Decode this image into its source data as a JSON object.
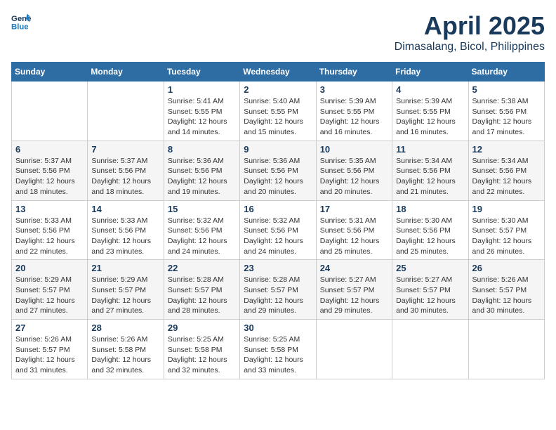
{
  "header": {
    "logo_line1": "General",
    "logo_line2": "Blue",
    "title": "April 2025",
    "subtitle": "Dimasalang, Bicol, Philippines"
  },
  "calendar": {
    "days_of_week": [
      "Sunday",
      "Monday",
      "Tuesday",
      "Wednesday",
      "Thursday",
      "Friday",
      "Saturday"
    ],
    "weeks": [
      [
        {
          "day": "",
          "info": ""
        },
        {
          "day": "",
          "info": ""
        },
        {
          "day": "1",
          "info": "Sunrise: 5:41 AM\nSunset: 5:55 PM\nDaylight: 12 hours\nand 14 minutes."
        },
        {
          "day": "2",
          "info": "Sunrise: 5:40 AM\nSunset: 5:55 PM\nDaylight: 12 hours\nand 15 minutes."
        },
        {
          "day": "3",
          "info": "Sunrise: 5:39 AM\nSunset: 5:55 PM\nDaylight: 12 hours\nand 16 minutes."
        },
        {
          "day": "4",
          "info": "Sunrise: 5:39 AM\nSunset: 5:55 PM\nDaylight: 12 hours\nand 16 minutes."
        },
        {
          "day": "5",
          "info": "Sunrise: 5:38 AM\nSunset: 5:56 PM\nDaylight: 12 hours\nand 17 minutes."
        }
      ],
      [
        {
          "day": "6",
          "info": "Sunrise: 5:37 AM\nSunset: 5:56 PM\nDaylight: 12 hours\nand 18 minutes."
        },
        {
          "day": "7",
          "info": "Sunrise: 5:37 AM\nSunset: 5:56 PM\nDaylight: 12 hours\nand 18 minutes."
        },
        {
          "day": "8",
          "info": "Sunrise: 5:36 AM\nSunset: 5:56 PM\nDaylight: 12 hours\nand 19 minutes."
        },
        {
          "day": "9",
          "info": "Sunrise: 5:36 AM\nSunset: 5:56 PM\nDaylight: 12 hours\nand 20 minutes."
        },
        {
          "day": "10",
          "info": "Sunrise: 5:35 AM\nSunset: 5:56 PM\nDaylight: 12 hours\nand 20 minutes."
        },
        {
          "day": "11",
          "info": "Sunrise: 5:34 AM\nSunset: 5:56 PM\nDaylight: 12 hours\nand 21 minutes."
        },
        {
          "day": "12",
          "info": "Sunrise: 5:34 AM\nSunset: 5:56 PM\nDaylight: 12 hours\nand 22 minutes."
        }
      ],
      [
        {
          "day": "13",
          "info": "Sunrise: 5:33 AM\nSunset: 5:56 PM\nDaylight: 12 hours\nand 22 minutes."
        },
        {
          "day": "14",
          "info": "Sunrise: 5:33 AM\nSunset: 5:56 PM\nDaylight: 12 hours\nand 23 minutes."
        },
        {
          "day": "15",
          "info": "Sunrise: 5:32 AM\nSunset: 5:56 PM\nDaylight: 12 hours\nand 24 minutes."
        },
        {
          "day": "16",
          "info": "Sunrise: 5:32 AM\nSunset: 5:56 PM\nDaylight: 12 hours\nand 24 minutes."
        },
        {
          "day": "17",
          "info": "Sunrise: 5:31 AM\nSunset: 5:56 PM\nDaylight: 12 hours\nand 25 minutes."
        },
        {
          "day": "18",
          "info": "Sunrise: 5:30 AM\nSunset: 5:56 PM\nDaylight: 12 hours\nand 25 minutes."
        },
        {
          "day": "19",
          "info": "Sunrise: 5:30 AM\nSunset: 5:57 PM\nDaylight: 12 hours\nand 26 minutes."
        }
      ],
      [
        {
          "day": "20",
          "info": "Sunrise: 5:29 AM\nSunset: 5:57 PM\nDaylight: 12 hours\nand 27 minutes."
        },
        {
          "day": "21",
          "info": "Sunrise: 5:29 AM\nSunset: 5:57 PM\nDaylight: 12 hours\nand 27 minutes."
        },
        {
          "day": "22",
          "info": "Sunrise: 5:28 AM\nSunset: 5:57 PM\nDaylight: 12 hours\nand 28 minutes."
        },
        {
          "day": "23",
          "info": "Sunrise: 5:28 AM\nSunset: 5:57 PM\nDaylight: 12 hours\nand 29 minutes."
        },
        {
          "day": "24",
          "info": "Sunrise: 5:27 AM\nSunset: 5:57 PM\nDaylight: 12 hours\nand 29 minutes."
        },
        {
          "day": "25",
          "info": "Sunrise: 5:27 AM\nSunset: 5:57 PM\nDaylight: 12 hours\nand 30 minutes."
        },
        {
          "day": "26",
          "info": "Sunrise: 5:26 AM\nSunset: 5:57 PM\nDaylight: 12 hours\nand 30 minutes."
        }
      ],
      [
        {
          "day": "27",
          "info": "Sunrise: 5:26 AM\nSunset: 5:57 PM\nDaylight: 12 hours\nand 31 minutes."
        },
        {
          "day": "28",
          "info": "Sunrise: 5:26 AM\nSunset: 5:58 PM\nDaylight: 12 hours\nand 32 minutes."
        },
        {
          "day": "29",
          "info": "Sunrise: 5:25 AM\nSunset: 5:58 PM\nDaylight: 12 hours\nand 32 minutes."
        },
        {
          "day": "30",
          "info": "Sunrise: 5:25 AM\nSunset: 5:58 PM\nDaylight: 12 hours\nand 33 minutes."
        },
        {
          "day": "",
          "info": ""
        },
        {
          "day": "",
          "info": ""
        },
        {
          "day": "",
          "info": ""
        }
      ]
    ]
  }
}
